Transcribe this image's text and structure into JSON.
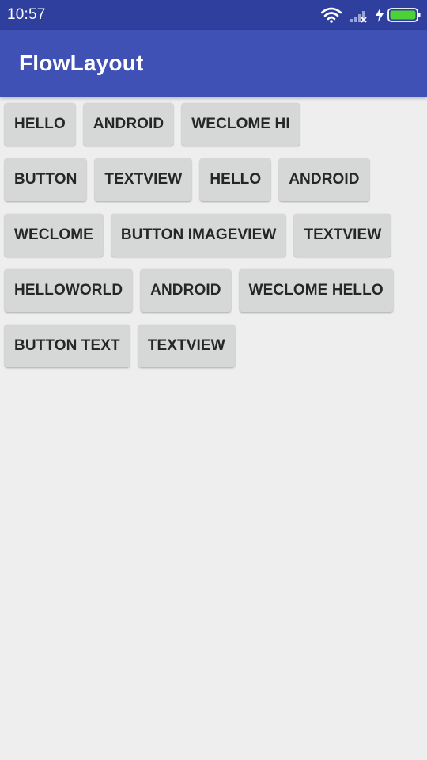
{
  "status_bar": {
    "time": "10:57"
  },
  "app_bar": {
    "title": "FlowLayout"
  },
  "colors": {
    "status_bar": "#2f3f9e",
    "app_bar": "#3f51b5",
    "background": "#eeeeee",
    "button": "#d6d7d7",
    "battery": "#4cd137"
  },
  "flow": {
    "rows": [
      [
        "HELLO",
        "ANDROID",
        "WECLOME HI"
      ],
      [
        "BUTTON",
        "TEXTVIEW",
        "HELLO",
        "ANDROID"
      ],
      [
        "WECLOME",
        "BUTTON IMAGEVIEW",
        "TEXTVIEW"
      ],
      [
        "HELLOWORLD",
        "ANDROID",
        "WECLOME HELLO"
      ],
      [
        "BUTTON TEXT",
        "TEXTVIEW"
      ]
    ]
  }
}
